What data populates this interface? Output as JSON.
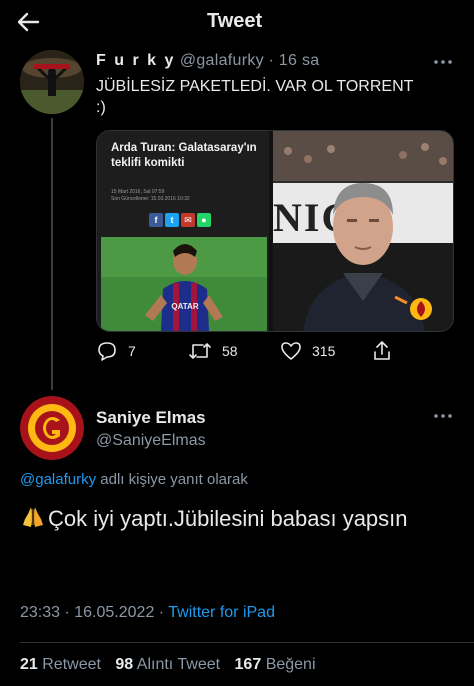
{
  "header": {
    "title": "Tweet"
  },
  "parent_tweet": {
    "display_name": "F u r k y",
    "handle": "@galafurky",
    "time": "· 16 sa",
    "text_line1": "JÜBİLESİZ PAKETLEDİ. VAR OL TORRENT",
    "text_line2": ":)",
    "media": {
      "article_title": "Arda Turan: Galatasaray'ın teklifi komikti",
      "article_meta_1": "15 Mart 2016, Sal 07:59",
      "article_meta_2": "Son Güncelleme: 15.03.2016 10:32",
      "stadium_text": "NICO",
      "jersey_text": "QATAR"
    },
    "actions": {
      "replies": "7",
      "retweets": "58",
      "likes": "315"
    }
  },
  "reply_tweet": {
    "display_name": "Saniye Elmas",
    "handle": "@SaniyeElmas",
    "reply_to_mention": "@galafurky",
    "reply_to_suffix": " adlı kişiye yanıt olarak",
    "text": "Çok iyi yaptı.Jübilesini babası yapsın",
    "time": "23:33 · 16.05.2022 · ",
    "source": "Twitter for iPad",
    "stats": {
      "retweets_count": "21",
      "retweets_label": "Retweet",
      "quotes_count": "98",
      "quotes_label": "Alıntı Tweet",
      "likes_count": "167",
      "likes_label": "Beğeni"
    }
  },
  "colors": {
    "background": "#000000",
    "text": "#e7e9ea",
    "muted": "#8b98a5",
    "accent": "#1d9bf0",
    "galatasaray_red": "#a8131b",
    "galatasaray_yellow": "#fdb912"
  },
  "icons": [
    "back-arrow-icon",
    "more-icon",
    "reply-icon",
    "retweet-icon",
    "like-icon",
    "share-icon",
    "folded-hands-emoji"
  ]
}
